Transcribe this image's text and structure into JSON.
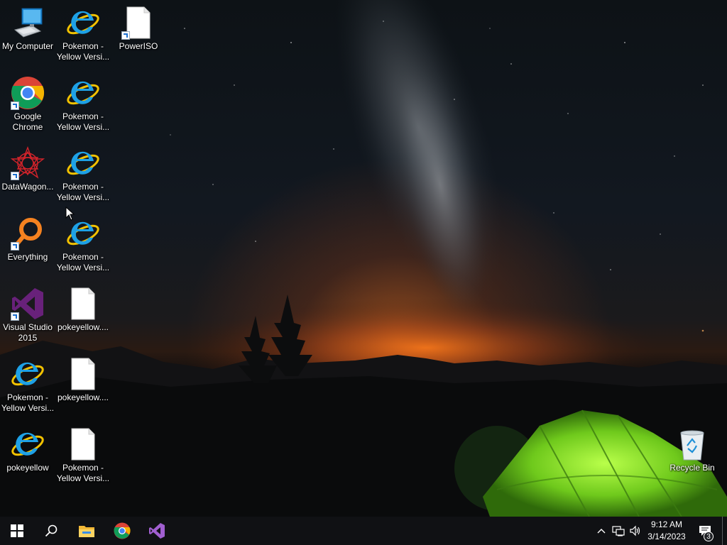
{
  "desktop": {
    "icons": [
      {
        "label": "My Computer",
        "icon": "computer-icon"
      },
      {
        "label": "Pokemon - Yellow Versi...",
        "icon": "ie-icon"
      },
      {
        "label": "PowerISO",
        "icon": "file-icon"
      },
      {
        "label": "Google Chrome",
        "icon": "chrome-icon"
      },
      {
        "label": "Pokemon - Yellow Versi...",
        "icon": "ie-icon"
      },
      {
        "label": "DataWagon...",
        "icon": "datawagon-icon"
      },
      {
        "label": "Pokemon - Yellow Versi...",
        "icon": "ie-icon"
      },
      {
        "label": "Everything",
        "icon": "everything-icon"
      },
      {
        "label": "Pokemon - Yellow Versi...",
        "icon": "ie-icon"
      },
      {
        "label": "Visual Studio 2015",
        "icon": "visual-studio-icon"
      },
      {
        "label": "pokeyellow....",
        "icon": "file-icon"
      },
      {
        "label": "Pokemon - Yellow Versi...",
        "icon": "ie-icon"
      },
      {
        "label": "pokeyellow....",
        "icon": "file-icon"
      },
      {
        "label": "pokeyellow",
        "icon": "ie-icon"
      },
      {
        "label": "Pokemon - Yellow Versi...",
        "icon": "file-icon"
      },
      {
        "label": "Recycle Bin",
        "icon": "recycle-bin-icon"
      }
    ]
  },
  "taskbar": {
    "pinned": [
      "start-icon",
      "search-icon",
      "file-explorer-icon",
      "chrome-icon",
      "visual-studio-icon"
    ],
    "tray": [
      "chevron-up-icon",
      "network-icon",
      "volume-icon"
    ],
    "clock": {
      "time": "9:12 AM",
      "date": "3/14/2023"
    },
    "notifications": {
      "count": "3"
    }
  },
  "colors": {
    "taskbar": "#101114",
    "accent": "#0078d7",
    "tent": "#7ed321"
  }
}
